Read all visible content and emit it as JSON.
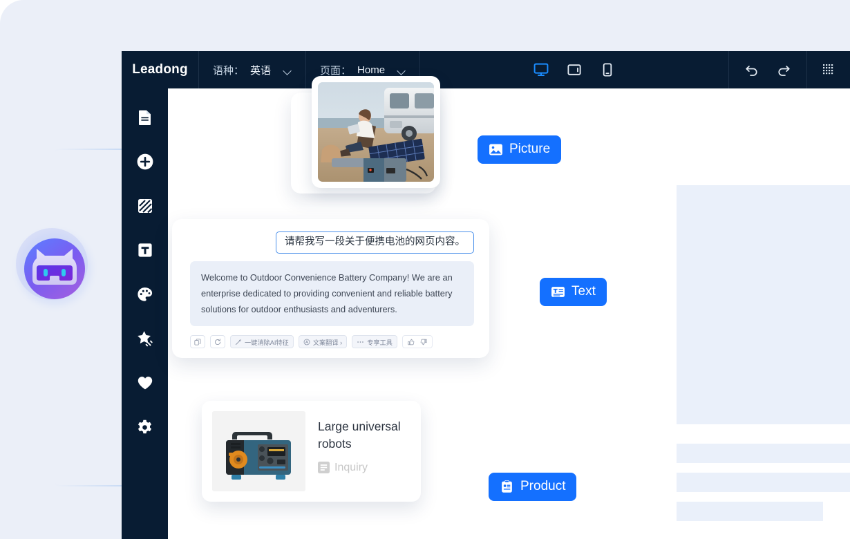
{
  "app": {
    "brand": "Leadong",
    "background_color": "#ebeff8",
    "panel_color": "#081c33",
    "accent_color": "#1470ff"
  },
  "topbar": {
    "language_label": "语种：",
    "language_value": "英语",
    "page_label": "页面：",
    "page_value": "Home",
    "devices": [
      {
        "name": "desktop-view",
        "icon": "monitor-icon",
        "active": true
      },
      {
        "name": "tablet-view",
        "icon": "tablet-icon",
        "active": false
      },
      {
        "name": "mobile-view",
        "icon": "phone-icon",
        "active": false
      }
    ],
    "undo_icon": "undo-icon",
    "redo_icon": "redo-icon",
    "grid_icon": "grid-dots-icon"
  },
  "rail": {
    "items": [
      {
        "name": "pages",
        "icon": "document-icon"
      },
      {
        "name": "add-section",
        "icon": "plus-circle-icon"
      },
      {
        "name": "media",
        "icon": "image-pattern-icon"
      },
      {
        "name": "text",
        "icon": "text-t-icon"
      },
      {
        "name": "theme",
        "icon": "palette-icon"
      },
      {
        "name": "ai-magic",
        "icon": "star-sparkle-icon"
      },
      {
        "name": "favorites",
        "icon": "heart-icon"
      },
      {
        "name": "settings",
        "icon": "gear-icon"
      }
    ]
  },
  "badges": {
    "picture": {
      "label": "Picture",
      "icon": "image-icon"
    },
    "text": {
      "label": "Text",
      "icon": "text-block-icon"
    },
    "product": {
      "label": "Product",
      "icon": "clipboard-icon"
    }
  },
  "chat": {
    "prompt": "请帮我写一段关于便携电池的网页内容。",
    "answer": "Welcome to Outdoor Convenience Battery Company! We are an enterprise dedicated to providing convenient and reliable battery solutions for outdoor enthusiasts and adventurers.",
    "tools": [
      {
        "name": "copy",
        "icon": "copy-icon",
        "label": ""
      },
      {
        "name": "regenerate",
        "icon": "refresh-icon",
        "label": ""
      },
      {
        "name": "remove-ai-traits",
        "icon": "wand-icon",
        "label": "一键消除AI特征"
      },
      {
        "name": "copy-translate",
        "icon": "translate-icon",
        "label": "文案翻译 ›"
      },
      {
        "name": "exclusive-tools",
        "icon": "ellipsis-icon",
        "label": "专享工具"
      },
      {
        "name": "feedback",
        "icon": "thumbs-icon",
        "label": ""
      }
    ]
  },
  "product_card": {
    "title": "Large universal robots",
    "inquiry_label": "Inquiry",
    "inquiry_icon": "list-icon"
  },
  "picture_card": {
    "alt": "woman relaxing beside RV with solar panel and portable power station on beach"
  },
  "mascot": {
    "name": "ai-assistant-mascot"
  }
}
